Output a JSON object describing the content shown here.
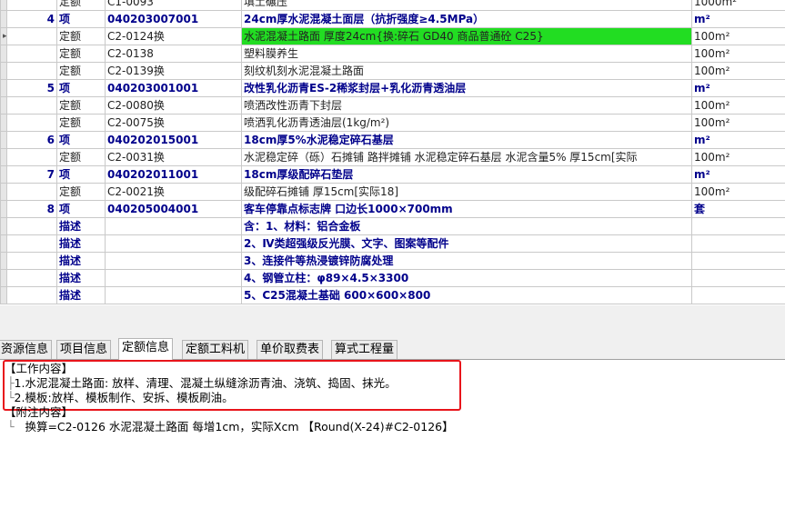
{
  "grid": {
    "rows": [
      {
        "kind": "quota",
        "no": "",
        "type": "定额",
        "code": "C1-0093",
        "name": "填土碾压",
        "unit": "1000m²",
        "partial": true
      },
      {
        "kind": "item",
        "no": "4",
        "type": "项",
        "code": "040203007001",
        "name": "24cm厚水泥混凝土面层（抗折强度≥4.5MPa）",
        "unit": "m²"
      },
      {
        "kind": "quota",
        "no": "",
        "type": "定额",
        "code": "C2-0124换",
        "name": "水泥混凝土路面 厚度24cm{换:碎石 GD40  商品普通砼  C25}",
        "unit": "100m²",
        "highlight": true,
        "current": true
      },
      {
        "kind": "quota",
        "no": "",
        "type": "定额",
        "code": "C2-0138",
        "name": "塑料膜养生",
        "unit": "100m²"
      },
      {
        "kind": "quota",
        "no": "",
        "type": "定额",
        "code": "C2-0139换",
        "name": "刻纹机刻水泥混凝土路面",
        "unit": "100m²"
      },
      {
        "kind": "item",
        "no": "5",
        "type": "项",
        "code": "040203001001",
        "name": "改性乳化沥青ES-2稀浆封层+乳化沥青透油层",
        "unit": "m²"
      },
      {
        "kind": "quota",
        "no": "",
        "type": "定额",
        "code": "C2-0080换",
        "name": "喷洒改性沥青下封层",
        "unit": "100m²"
      },
      {
        "kind": "quota",
        "no": "",
        "type": "定额",
        "code": "C2-0075换",
        "name": "喷洒乳化沥青透油层(1kg/m²)",
        "unit": "100m²"
      },
      {
        "kind": "item",
        "no": "6",
        "type": "项",
        "code": "040202015001",
        "name": "18cm厚5%水泥稳定碎石基层",
        "unit": "m²"
      },
      {
        "kind": "quota",
        "no": "",
        "type": "定额",
        "code": "C2-0031换",
        "name": "水泥稳定碎（砾）石摊铺 路拌摊铺 水泥稳定碎石基层 水泥含量5% 厚15cm[实际",
        "unit": "100m²"
      },
      {
        "kind": "item",
        "no": "7",
        "type": "项",
        "code": "040202011001",
        "name": "18cm厚级配碎石垫层",
        "unit": "m²"
      },
      {
        "kind": "quota",
        "no": "",
        "type": "定额",
        "code": "C2-0021换",
        "name": "级配碎石摊铺 厚15cm[实际18]",
        "unit": "100m²"
      },
      {
        "kind": "item",
        "no": "8",
        "type": "项",
        "code": "040205004001",
        "name": "客车停靠点标志牌 口边长1000×700mm",
        "unit": "套"
      },
      {
        "kind": "desc",
        "no": "",
        "type": "描述",
        "code": "",
        "name": "含：1、材料：铝合金板",
        "unit": "",
        "indent": 1
      },
      {
        "kind": "desc",
        "no": "",
        "type": "描述",
        "code": "",
        "name": "2、Ⅳ类超强级反光膜、文字、图案等配件",
        "unit": "",
        "indent": 2
      },
      {
        "kind": "desc",
        "no": "",
        "type": "描述",
        "code": "",
        "name": "3、连接件等热浸镀锌防腐处理",
        "unit": "",
        "indent": 2
      },
      {
        "kind": "desc",
        "no": "",
        "type": "描述",
        "code": "",
        "name": "4、钢管立柱：φ89×4.5×3300",
        "unit": "",
        "indent": 2
      },
      {
        "kind": "desc",
        "no": "",
        "type": "描述",
        "code": "",
        "name": "5、C25混凝土基础 600×600×800",
        "unit": "",
        "indent": 2
      }
    ]
  },
  "tabs": [
    "资源信息",
    "项目信息",
    "定额信息",
    "定额工料机",
    "单价取费表",
    "算式工程量"
  ],
  "active_tab": "定额信息",
  "detail": {
    "work_header": "【工作内容】",
    "work_items": [
      "1.水泥混凝土路面: 放样、清理、混凝土纵缝涂沥青油、浇筑、捣固、抹光。",
      "2.模板:放样、模板制作、安拆、模板刷油。"
    ],
    "note_header": "【附注内容】",
    "note_items": [
      "换算=C2-0126 水泥混凝土路面 每增1cm，实际Xcm 【Round(X-24)#C2-0126】"
    ],
    "tree_branch": "└",
    "tree_mid": "├",
    "highlight_color": "#e8141b"
  },
  "current_row_marker": "▸"
}
